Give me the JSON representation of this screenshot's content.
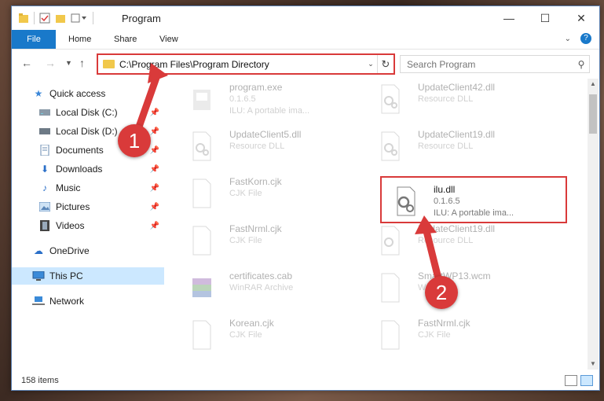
{
  "window": {
    "title": "Program"
  },
  "ribbon": {
    "tabs": [
      "File",
      "Home",
      "Share",
      "View"
    ]
  },
  "address": {
    "path": "C:\\Program Files\\Program Directory"
  },
  "search": {
    "placeholder": "Search Program"
  },
  "sidebar": {
    "items": [
      {
        "label": "Quick access",
        "icon": "star-icon",
        "pinned": false
      },
      {
        "label": "Local Disk (C:)",
        "icon": "drive-icon",
        "pinned": true
      },
      {
        "label": "Local Disk (D:)",
        "icon": "drive-icon",
        "pinned": true
      },
      {
        "label": "Documents",
        "icon": "documents-icon",
        "pinned": true
      },
      {
        "label": "Downloads",
        "icon": "download-icon",
        "pinned": true
      },
      {
        "label": "Music",
        "icon": "music-icon",
        "pinned": true
      },
      {
        "label": "Pictures",
        "icon": "pictures-icon",
        "pinned": true
      },
      {
        "label": "Videos",
        "icon": "videos-icon",
        "pinned": true
      },
      {
        "label": "OneDrive",
        "icon": "cloud-icon",
        "pinned": false
      },
      {
        "label": "This PC",
        "icon": "computer-icon",
        "pinned": false
      },
      {
        "label": "Network",
        "icon": "network-icon",
        "pinned": false
      }
    ]
  },
  "files": [
    {
      "name": "program.exe",
      "line1": "0.1.6.5",
      "line2": "ILU: A portable ima...",
      "type": "exe"
    },
    {
      "name": "UpdateClient42.dll",
      "line1": "Resource DLL",
      "line2": "",
      "type": "dll"
    },
    {
      "name": "UpdateClient5.dll",
      "line1": "Resource DLL",
      "line2": "",
      "type": "dll"
    },
    {
      "name": "UpdateClient19.dll",
      "line1": "Resource DLL",
      "line2": "",
      "type": "dll"
    },
    {
      "name": "FastKorn.cjk",
      "line1": "CJK File",
      "line2": "",
      "type": "doc"
    },
    {
      "name": "ilu.dll",
      "line1": "0.1.6.5",
      "line2": "ILU: A portable ima...",
      "type": "dll"
    },
    {
      "name": "FastNrml.cjk",
      "line1": "CJK File",
      "line2": "",
      "type": "doc"
    },
    {
      "name": "UpdateClient19.dll",
      "line1": "Resource DLL",
      "line2": "",
      "type": "dll"
    },
    {
      "name": "certificates.cab",
      "line1": "WinRAR Archive",
      "line2": "",
      "type": "rar"
    },
    {
      "name": "SmartWP13.wcm",
      "line1": "WCM File",
      "line2": "",
      "type": "doc"
    },
    {
      "name": "Korean.cjk",
      "line1": "CJK File",
      "line2": "",
      "type": "doc"
    },
    {
      "name": "FastNrml.cjk",
      "line1": "CJK File",
      "line2": "",
      "type": "doc"
    }
  ],
  "status": {
    "count": "158 items"
  },
  "annotations": {
    "one": "1",
    "two": "2"
  },
  "colors": {
    "accent": "#1979ca",
    "annotation": "#d93a3a",
    "selected": "#cce8ff"
  }
}
